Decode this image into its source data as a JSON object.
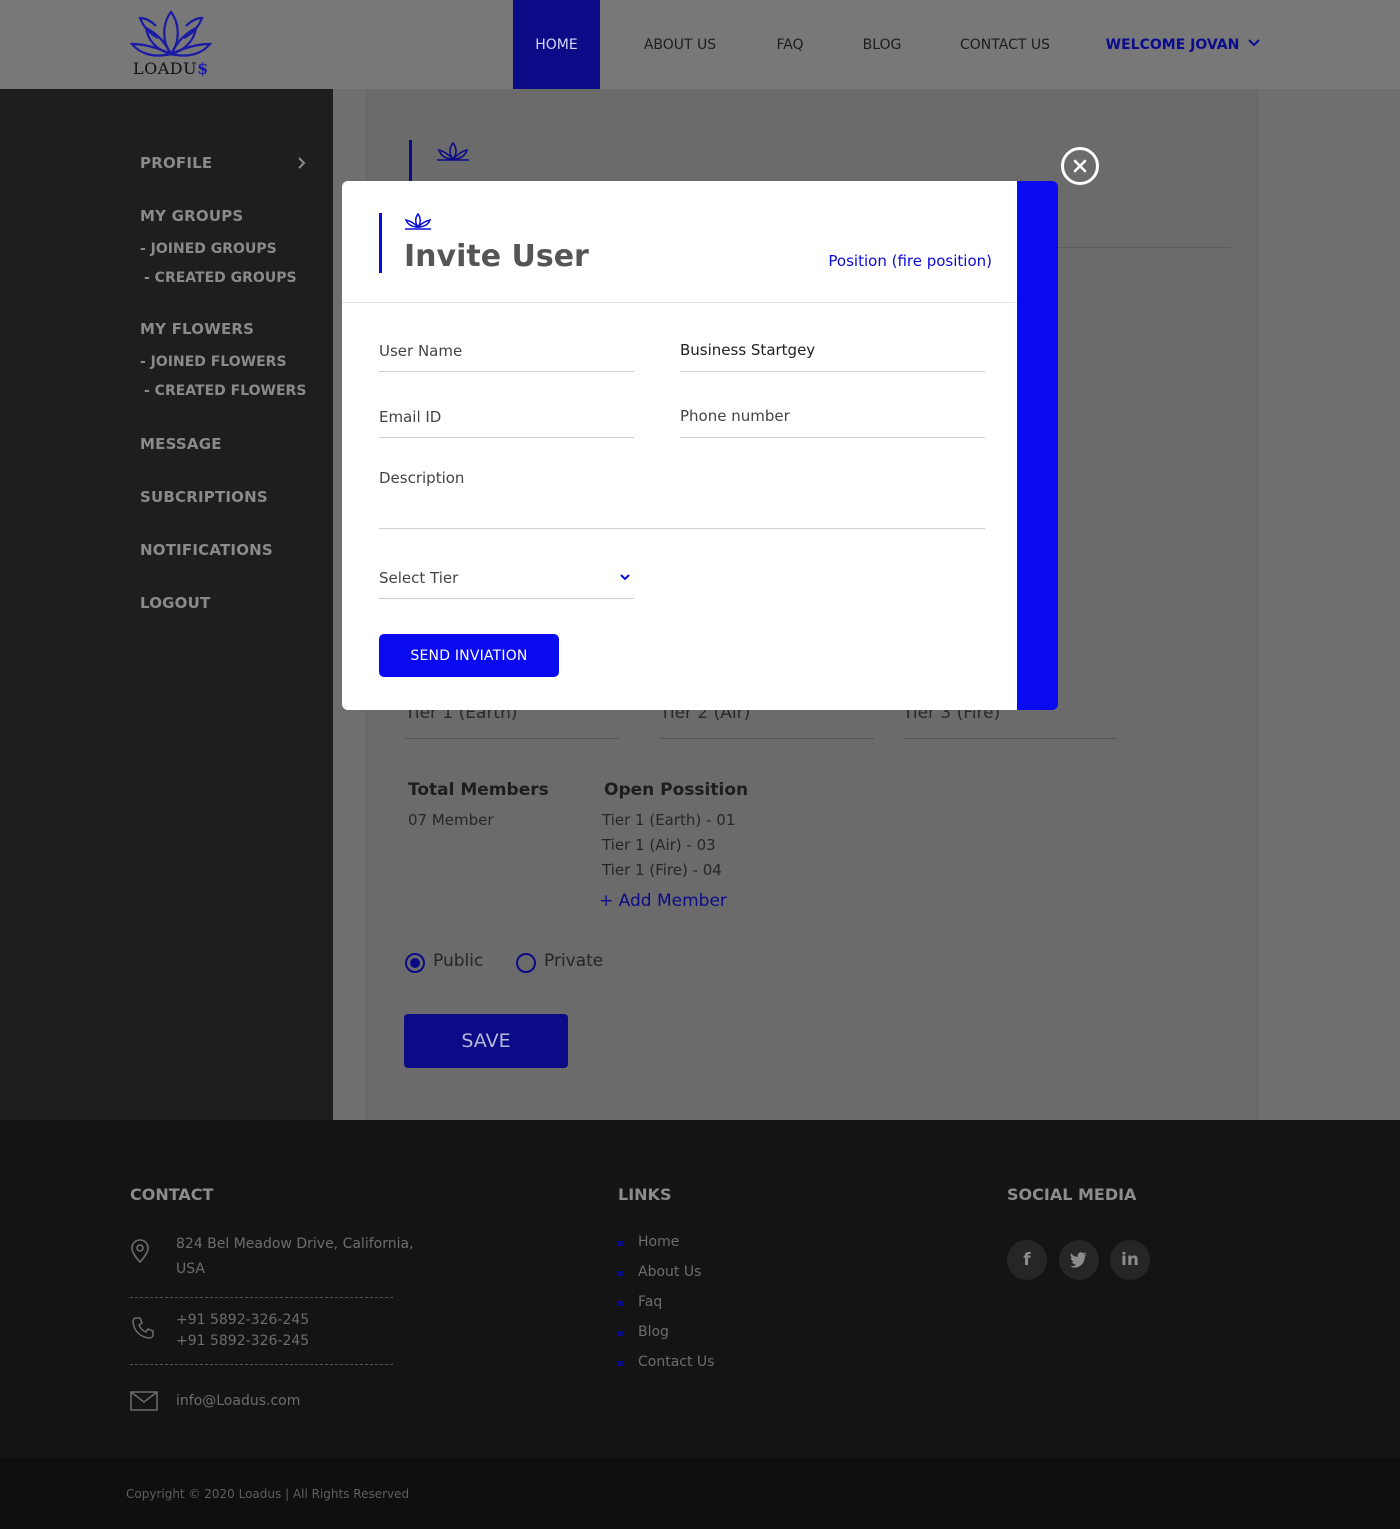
{
  "header": {
    "logo_text": "LOADU",
    "logo_dollar": "$",
    "nav": [
      "HOME",
      "ABOUT US",
      "FAQ",
      "BLOG",
      "CONTACT US"
    ],
    "welcome": "WELCOME JOVAN"
  },
  "sidebar": {
    "profile": "PROFILE",
    "my_groups": "MY GROUPS",
    "joined_groups": "-  JOINED GROUPS",
    "created_groups": "-  CREATED GROUPS",
    "my_flowers": "MY FLOWERS",
    "joined_flowers": "-  JOINED FLOWERS",
    "created_flowers": "-  CREATED FLOWERS",
    "message": "MESSAGE",
    "subscriptions": "SUBCRIPTIONS",
    "notifications": "NOTIFICATIONS",
    "logout": "LOGOUT"
  },
  "main": {
    "tiers": [
      "Tier 1 (Earth)",
      "Tier 2 (Air)",
      "Tier 3 (Fire)"
    ],
    "total_members_label": "Total Members",
    "total_members_value": "07 Member",
    "open_position_label": "Open Possition",
    "open_positions": [
      "Tier 1 (Earth) - 01",
      "Tier 1 (Air) - 03",
      "Tier 1 (Fire) - 04"
    ],
    "add_member": "+ Add Member",
    "visibility_options": [
      "Public",
      "Private"
    ],
    "visibility_selected": "Public",
    "save": "SAVE"
  },
  "modal": {
    "title": "Invite User",
    "position": "Position (fire position)",
    "user_name_placeholder": "User Name",
    "business_value": "Business Startgey",
    "email_placeholder": "Email ID",
    "phone_placeholder": "Phone number",
    "description_placeholder": "Description",
    "select_tier": "Select Tier",
    "send": "SEND INVIATION"
  },
  "footer": {
    "contact_heading": "CONTACT",
    "address_line1": "824 Bel Meadow Drive, California,",
    "address_line2": "USA",
    "phone1": "+91 5892-326-245",
    "phone2": "+91 5892-326-245",
    "email": "info@Loadus.com",
    "links_heading": "LINKS",
    "links": [
      "Home",
      "About Us",
      "Faq",
      "Blog",
      "Contact Us"
    ],
    "social_heading": "SOCIAL MEDIA",
    "social": [
      "f",
      "t",
      "in"
    ],
    "copyright": "Copyright © 2020 Loadus | All Rights Reserved"
  },
  "colors": {
    "brand": "#0b0b87",
    "modal_accent": "#0a0af0"
  },
  "icons": [
    "lotus-logo-icon",
    "chevron-right-icon",
    "chevron-down-icon",
    "close-icon",
    "location-pin-icon",
    "phone-icon",
    "envelope-icon",
    "facebook-icon",
    "twitter-icon",
    "linkedin-icon"
  ]
}
